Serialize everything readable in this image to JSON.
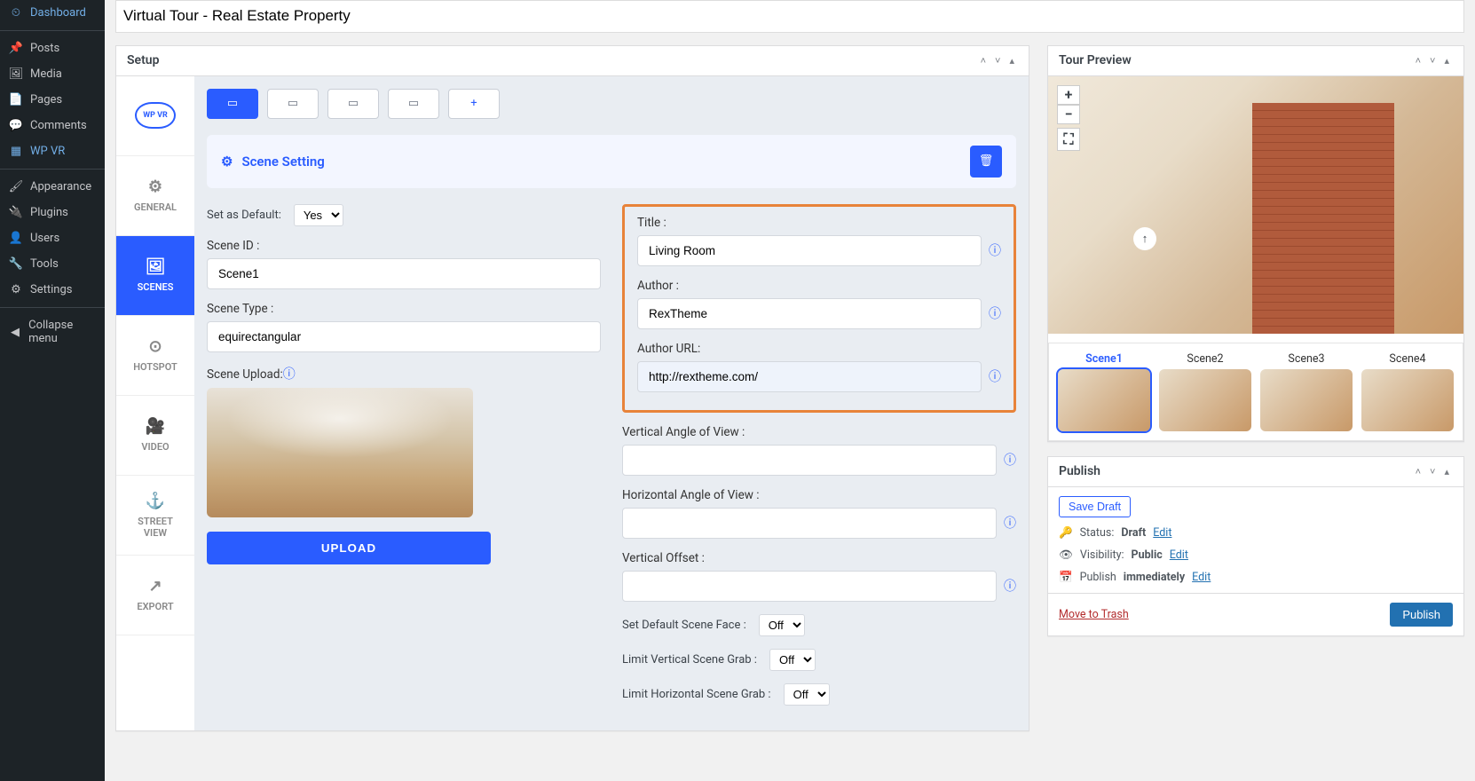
{
  "wp_sidebar": {
    "items": [
      {
        "icon": "⏲",
        "label": "Dashboard"
      },
      {
        "icon": "📌",
        "label": "Posts"
      },
      {
        "icon": "🖼",
        "label": "Media"
      },
      {
        "icon": "📄",
        "label": "Pages"
      },
      {
        "icon": "💬",
        "label": "Comments"
      },
      {
        "icon": "▦",
        "label": "WP VR"
      },
      {
        "icon": "🖌",
        "label": "Appearance"
      },
      {
        "icon": "🔌",
        "label": "Plugins"
      },
      {
        "icon": "👤",
        "label": "Users"
      },
      {
        "icon": "🔧",
        "label": "Tools"
      },
      {
        "icon": "⚙",
        "label": "Settings"
      },
      {
        "icon": "◀",
        "label": "Collapse menu"
      }
    ]
  },
  "page_title": "Virtual Tour - Real Estate Property",
  "setup_panel_title": "Setup",
  "side_tabs": {
    "logo": "WP VR",
    "general": "GENERAL",
    "scenes": "SCENES",
    "hotspot": "HOTSPOT",
    "video": "VIDEO",
    "street_view": "STREET\nVIEW",
    "export": "EXPORT"
  },
  "scene_setting_title": "Scene Setting",
  "scene_tabs_add": "+",
  "left_form": {
    "set_default_label": "Set as Default:",
    "set_default_value": "Yes",
    "scene_id_label": "Scene ID :",
    "scene_id_value": "Scene1",
    "scene_type_label": "Scene Type :",
    "scene_type_value": "equirectangular",
    "scene_upload_label": "Scene Upload:",
    "upload_btn": "UPLOAD"
  },
  "right_form": {
    "title_label": "Title :",
    "title_value": "Living Room",
    "author_label": "Author :",
    "author_value": "RexTheme",
    "author_url_label": "Author URL:",
    "author_url_value": "http://rextheme.com/",
    "vangle_label": "Vertical Angle of View :",
    "hangle_label": "Horizontal Angle of View :",
    "voffset_label": "Vertical Offset :",
    "default_face_label": "Set Default Scene Face :",
    "default_face_value": "Off",
    "limit_v_label": "Limit Vertical Scene Grab :",
    "limit_v_value": "Off",
    "limit_h_label": "Limit Horizontal Scene Grab :",
    "limit_h_value": "Off"
  },
  "tour_preview": {
    "title": "Tour Preview",
    "plus": "+",
    "minus": "−",
    "fs": "⛶",
    "hotspot": "↑",
    "scenes": [
      {
        "label": "Scene1"
      },
      {
        "label": "Scene2"
      },
      {
        "label": "Scene3"
      },
      {
        "label": "Scene4"
      }
    ]
  },
  "publish": {
    "title": "Publish",
    "save_draft": "Save Draft",
    "status_label": "Status:",
    "status_value": "Draft",
    "visibility_label": "Visibility:",
    "visibility_value": "Public",
    "publish_label": "Publish",
    "publish_value": "immediately",
    "edit": "Edit",
    "trash": "Move to Trash",
    "publish_btn": "Publish"
  }
}
